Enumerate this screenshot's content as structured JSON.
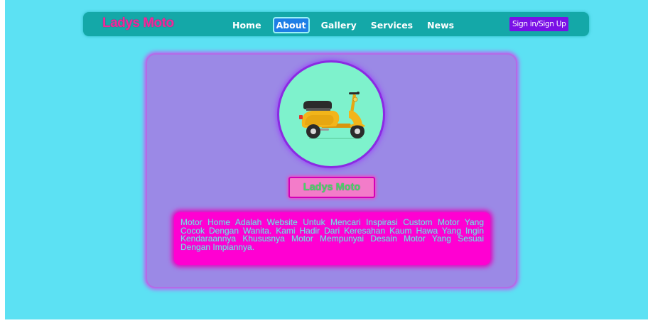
{
  "navbar": {
    "brand": "Ladys Moto",
    "links": [
      {
        "label": "Home",
        "active": false
      },
      {
        "label": "About",
        "active": true
      },
      {
        "label": "Gallery",
        "active": false
      },
      {
        "label": "Services",
        "active": false
      },
      {
        "label": "News",
        "active": false
      }
    ],
    "signin_label": "Sign in/Sign Up"
  },
  "card": {
    "image_icon": "scooter-icon",
    "title": "Ladys Moto",
    "description": "Motor Home Adalah Website Untuk Mencari Inspirasi Custom Motor Yang Cocok Dengan Wanita. Kami Hadir Dari Keresahan Kaum Hawa Yang Ingin Kendaraannya Khususnya Motor Mempunyai Desain Motor Yang Sesuai Dengan Impiannya."
  },
  "colors": {
    "page_bg": "#5ce1f3",
    "navbar_bg": "#14a8a8",
    "brand_text": "#ee2a9c",
    "active_link_bg": "#1e7fe6",
    "signin_bg": "#7a10e6",
    "card_bg": "#9b89e6",
    "avatar_bg": "#7ef2cc",
    "title_bg": "#f37cc9",
    "title_text": "#47d667",
    "desc_bg": "#ff00d2",
    "desc_text": "#8ad3e8"
  }
}
